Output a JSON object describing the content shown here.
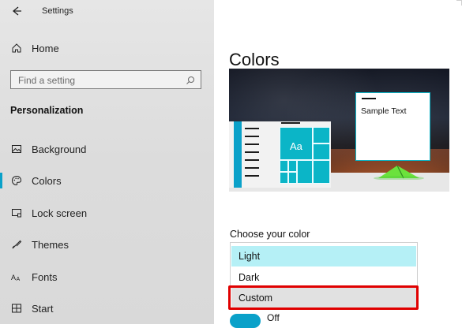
{
  "window": {
    "title": "Settings"
  },
  "sidebar": {
    "home_label": "Home",
    "search_placeholder": "Find a setting",
    "section_title": "Personalization",
    "items": [
      {
        "label": "Background",
        "icon": "image-icon"
      },
      {
        "label": "Colors",
        "icon": "palette-icon",
        "selected": true
      },
      {
        "label": "Lock screen",
        "icon": "lock-screen-icon"
      },
      {
        "label": "Themes",
        "icon": "brush-icon"
      },
      {
        "label": "Fonts",
        "icon": "fonts-icon"
      },
      {
        "label": "Start",
        "icon": "start-grid-icon"
      }
    ]
  },
  "main": {
    "page_title": "Colors",
    "preview": {
      "sample_text": "Sample Text",
      "tile_text": "Aa"
    },
    "choose_color_label": "Choose your color",
    "dropdown_options": [
      "Light",
      "Dark",
      "Custom"
    ],
    "selected_option": "Light",
    "highlighted_option": "Custom",
    "toggle_state_text": "Off"
  },
  "colors": {
    "accent": "#0aa1c9",
    "tile": "#0bb5c7",
    "highlight_red": "#e00000",
    "selected_option_bg": "#b5f0f6"
  }
}
